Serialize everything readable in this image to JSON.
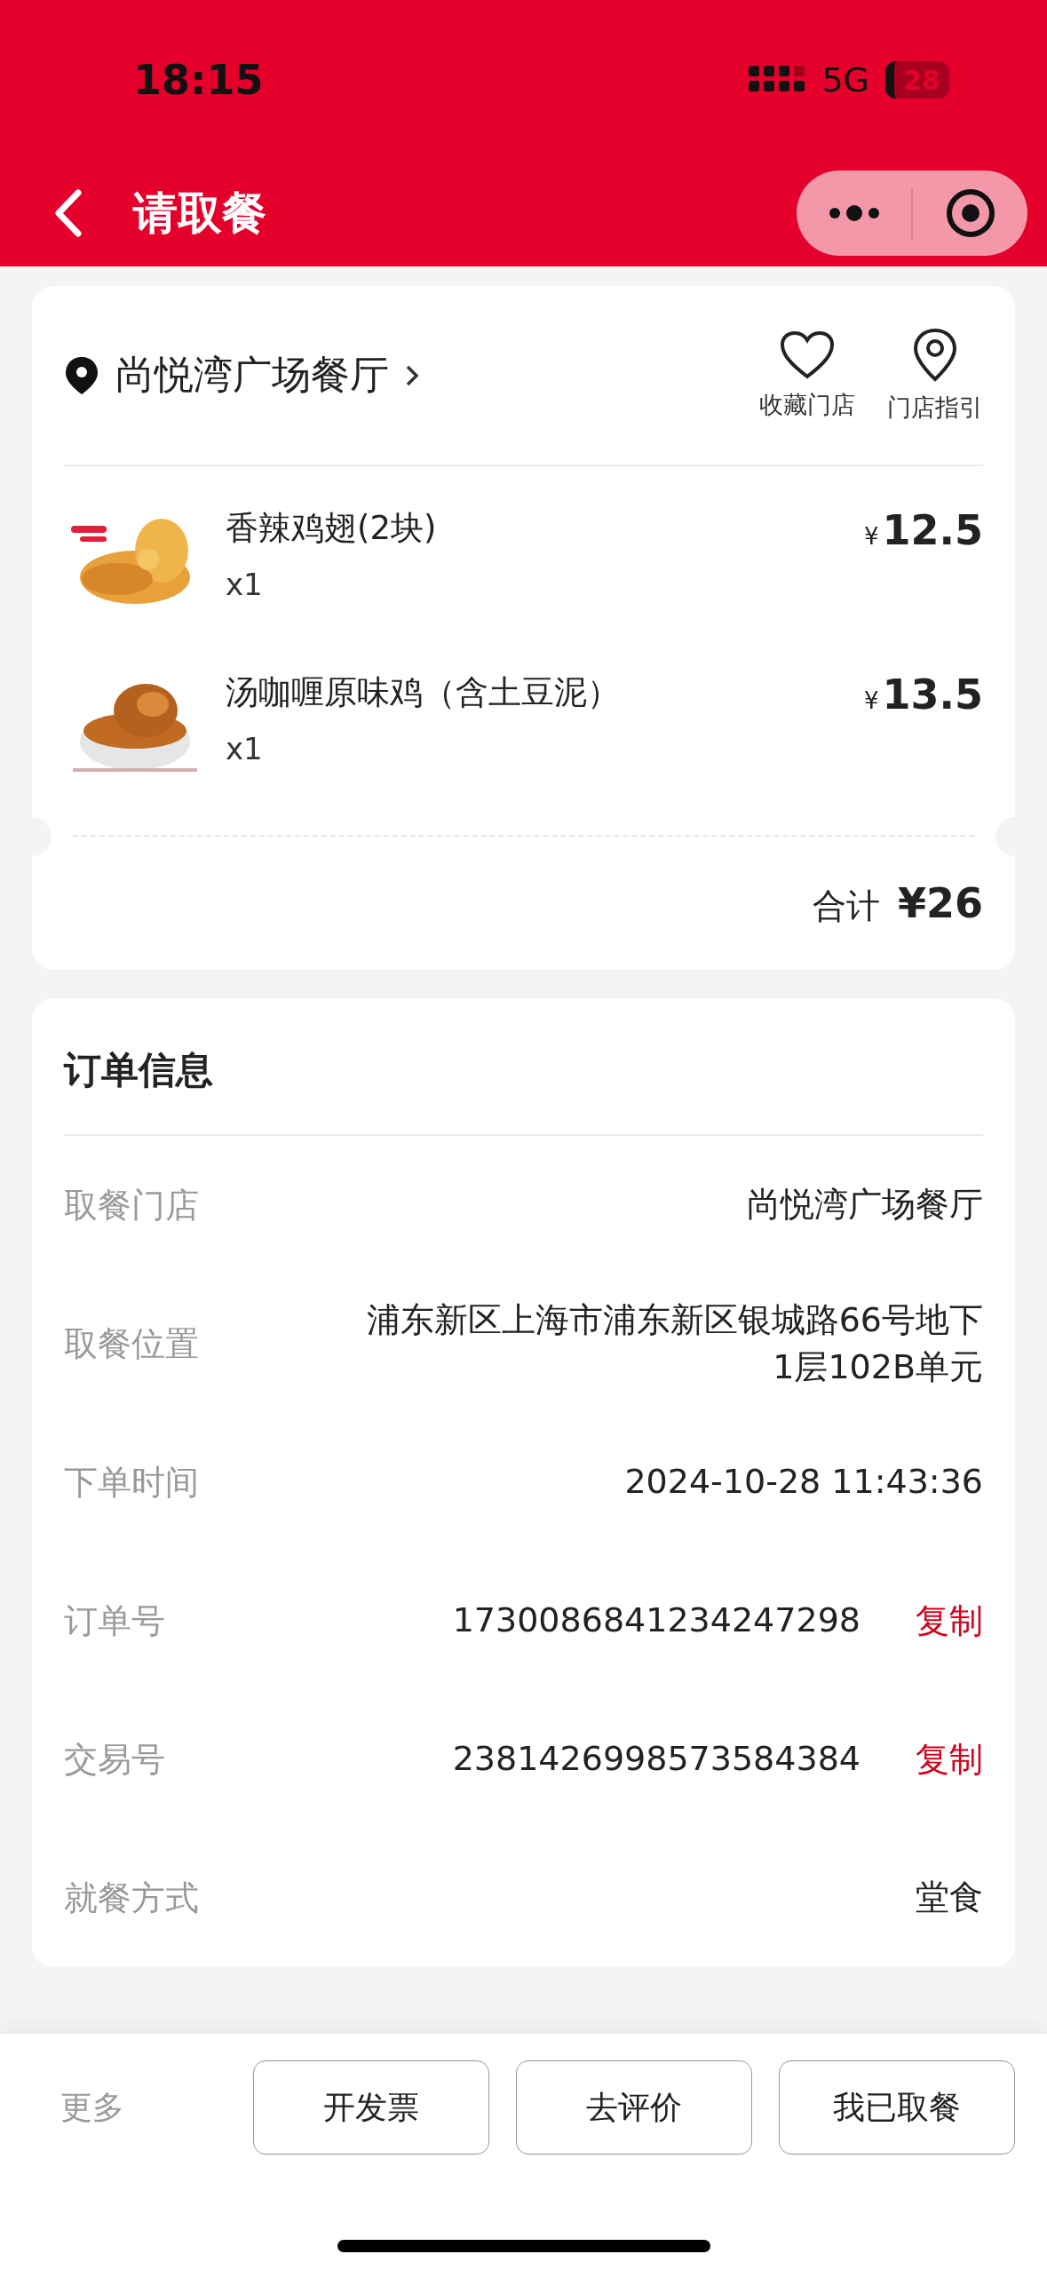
{
  "status_bar": {
    "time": "18:15",
    "network": "5G",
    "battery": "28"
  },
  "nav": {
    "title": "请取餐"
  },
  "store": {
    "name": "尚悦湾广场餐厅",
    "actions": [
      {
        "kind": "favorite",
        "label": "收藏门店"
      },
      {
        "kind": "guide",
        "label": "门店指引"
      }
    ]
  },
  "items": [
    {
      "name": "香辣鸡翅(2块)",
      "qty": "x1",
      "currency": "¥",
      "price": "12.5"
    },
    {
      "name": "汤咖喱原味鸡（含土豆泥）",
      "qty": "x1",
      "currency": "¥",
      "price": "13.5"
    }
  ],
  "total": {
    "label": "合计",
    "amount": "¥26"
  },
  "order_info": {
    "title": "订单信息",
    "rows": [
      {
        "label": "取餐门店",
        "value": "尚悦湾广场餐厅"
      },
      {
        "label": "取餐位置",
        "value": "浦东新区上海市浦东新区银城路66号地下1层102B单元"
      },
      {
        "label": "下单时间",
        "value": "2024-10-28 11:43:36"
      },
      {
        "label": "订单号",
        "value": "1730086841234247298",
        "action": "复制"
      },
      {
        "label": "交易号",
        "value": "2381426998573584384",
        "action": "复制"
      },
      {
        "label": "就餐方式",
        "value": "堂食"
      }
    ]
  },
  "footer": {
    "more": "更多",
    "buttons": [
      "开发票",
      "去评价",
      "我已取餐"
    ]
  }
}
